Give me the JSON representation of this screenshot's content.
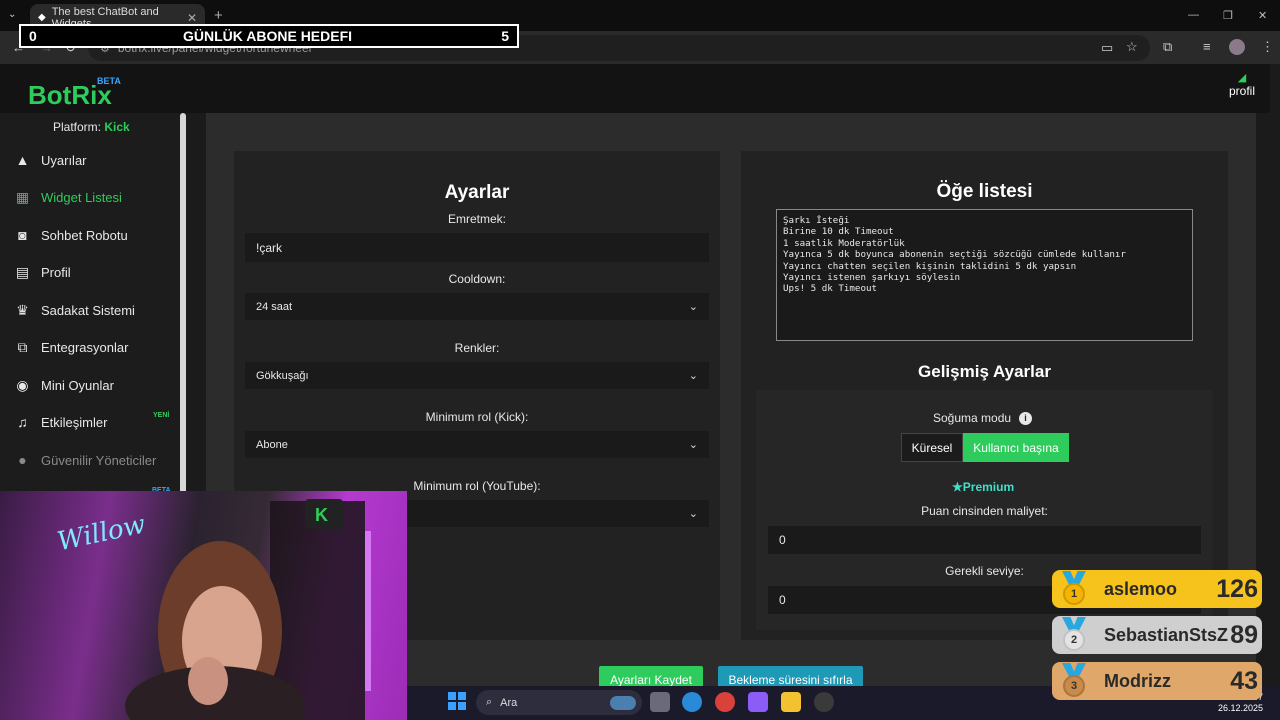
{
  "browser": {
    "tab_title": "The best ChatBot and Widgets",
    "url": "botrix.live/panel/widget/fortunewheel",
    "new_tab": "+"
  },
  "overlay_goal": {
    "left_value": "0",
    "title": "GÜNLÜK ABONE HEDEFI",
    "right_value": "5"
  },
  "header": {
    "logo": "BotRix",
    "beta": "BETA",
    "profile_label": "profil"
  },
  "sidebar": {
    "platform_label": "Platform:",
    "platform_value": "Kick",
    "items": [
      {
        "label": "Uyarılar",
        "icon": "warning-icon"
      },
      {
        "label": "Widget Listesi",
        "icon": "grid-icon"
      },
      {
        "label": "Sohbet Robotu",
        "icon": "robot-icon"
      },
      {
        "label": "Profil",
        "icon": "id-card-icon"
      },
      {
        "label": "Sadakat Sistemi",
        "icon": "trophy-icon"
      },
      {
        "label": "Entegrasyonlar",
        "icon": "integration-icon"
      },
      {
        "label": "Mini Oyunlar",
        "icon": "gamepad-icon"
      },
      {
        "label": "Etkileşimler",
        "icon": "music-icon"
      },
      {
        "label": "Güvenilir Yöneticiler",
        "icon": "users-icon"
      }
    ],
    "new_badge": "YENİ",
    "beta_badge": "BETA"
  },
  "settings": {
    "title": "Ayarlar",
    "command_label": "Emretmek:",
    "command_value": "!çark",
    "cooldown_label": "Cooldown:",
    "cooldown_value": "24 saat",
    "colors_label": "Renkler:",
    "colors_value": "Gökkuşağı",
    "min_role_kick_label": "Minimum rol (Kick):",
    "min_role_kick_value": "Abone",
    "min_role_youtube_label": "Minimum rol (YouTube):",
    "save_button": "Ayarları Kaydet",
    "reset_button": "Bekleme süresini sıfırla"
  },
  "item_list": {
    "title": "Öğe listesi",
    "items": "Şarkı İsteği\nBirine 10 dk Timeout\n1 saatlik Moderatörlük\nYayınca 5 dk boyunca abonenin seçtiği sözcüğü cümlede kullanır\nYayıncı chatten seçilen kişinin taklidini 5 dk yapsın\nYayıncı istenen şarkıyı söylesin\nUps! 5 dk Timeout"
  },
  "advanced": {
    "title": "Gelişmiş Ayarlar",
    "cooldown_mode_label": "Soğuma modu",
    "mode_global": "Küresel",
    "mode_per_user": "Kullanıcı başına",
    "premium_label": "Premium",
    "cost_label": "Puan cinsinden maliyet:",
    "cost_value": "0",
    "level_label": "Gerekli seviye:",
    "level_value": "0"
  },
  "taskbar": {
    "search_placeholder": "Ara",
    "date": "26.12.2025",
    "time_partial": "37"
  },
  "leaderboard": [
    {
      "rank": "1",
      "name": "aslemoo",
      "score": "126"
    },
    {
      "rank": "2",
      "name": "SebastianStsZ",
      "score": "89"
    },
    {
      "rank": "3",
      "name": "Modrizz",
      "score": "43"
    }
  ],
  "colors": {
    "accent_green": "#2ecc5c",
    "button_blue": "#1e9ab7",
    "gold": "#f6c21c",
    "silver": "#cfcfcf",
    "bronze": "#e0a76a"
  }
}
